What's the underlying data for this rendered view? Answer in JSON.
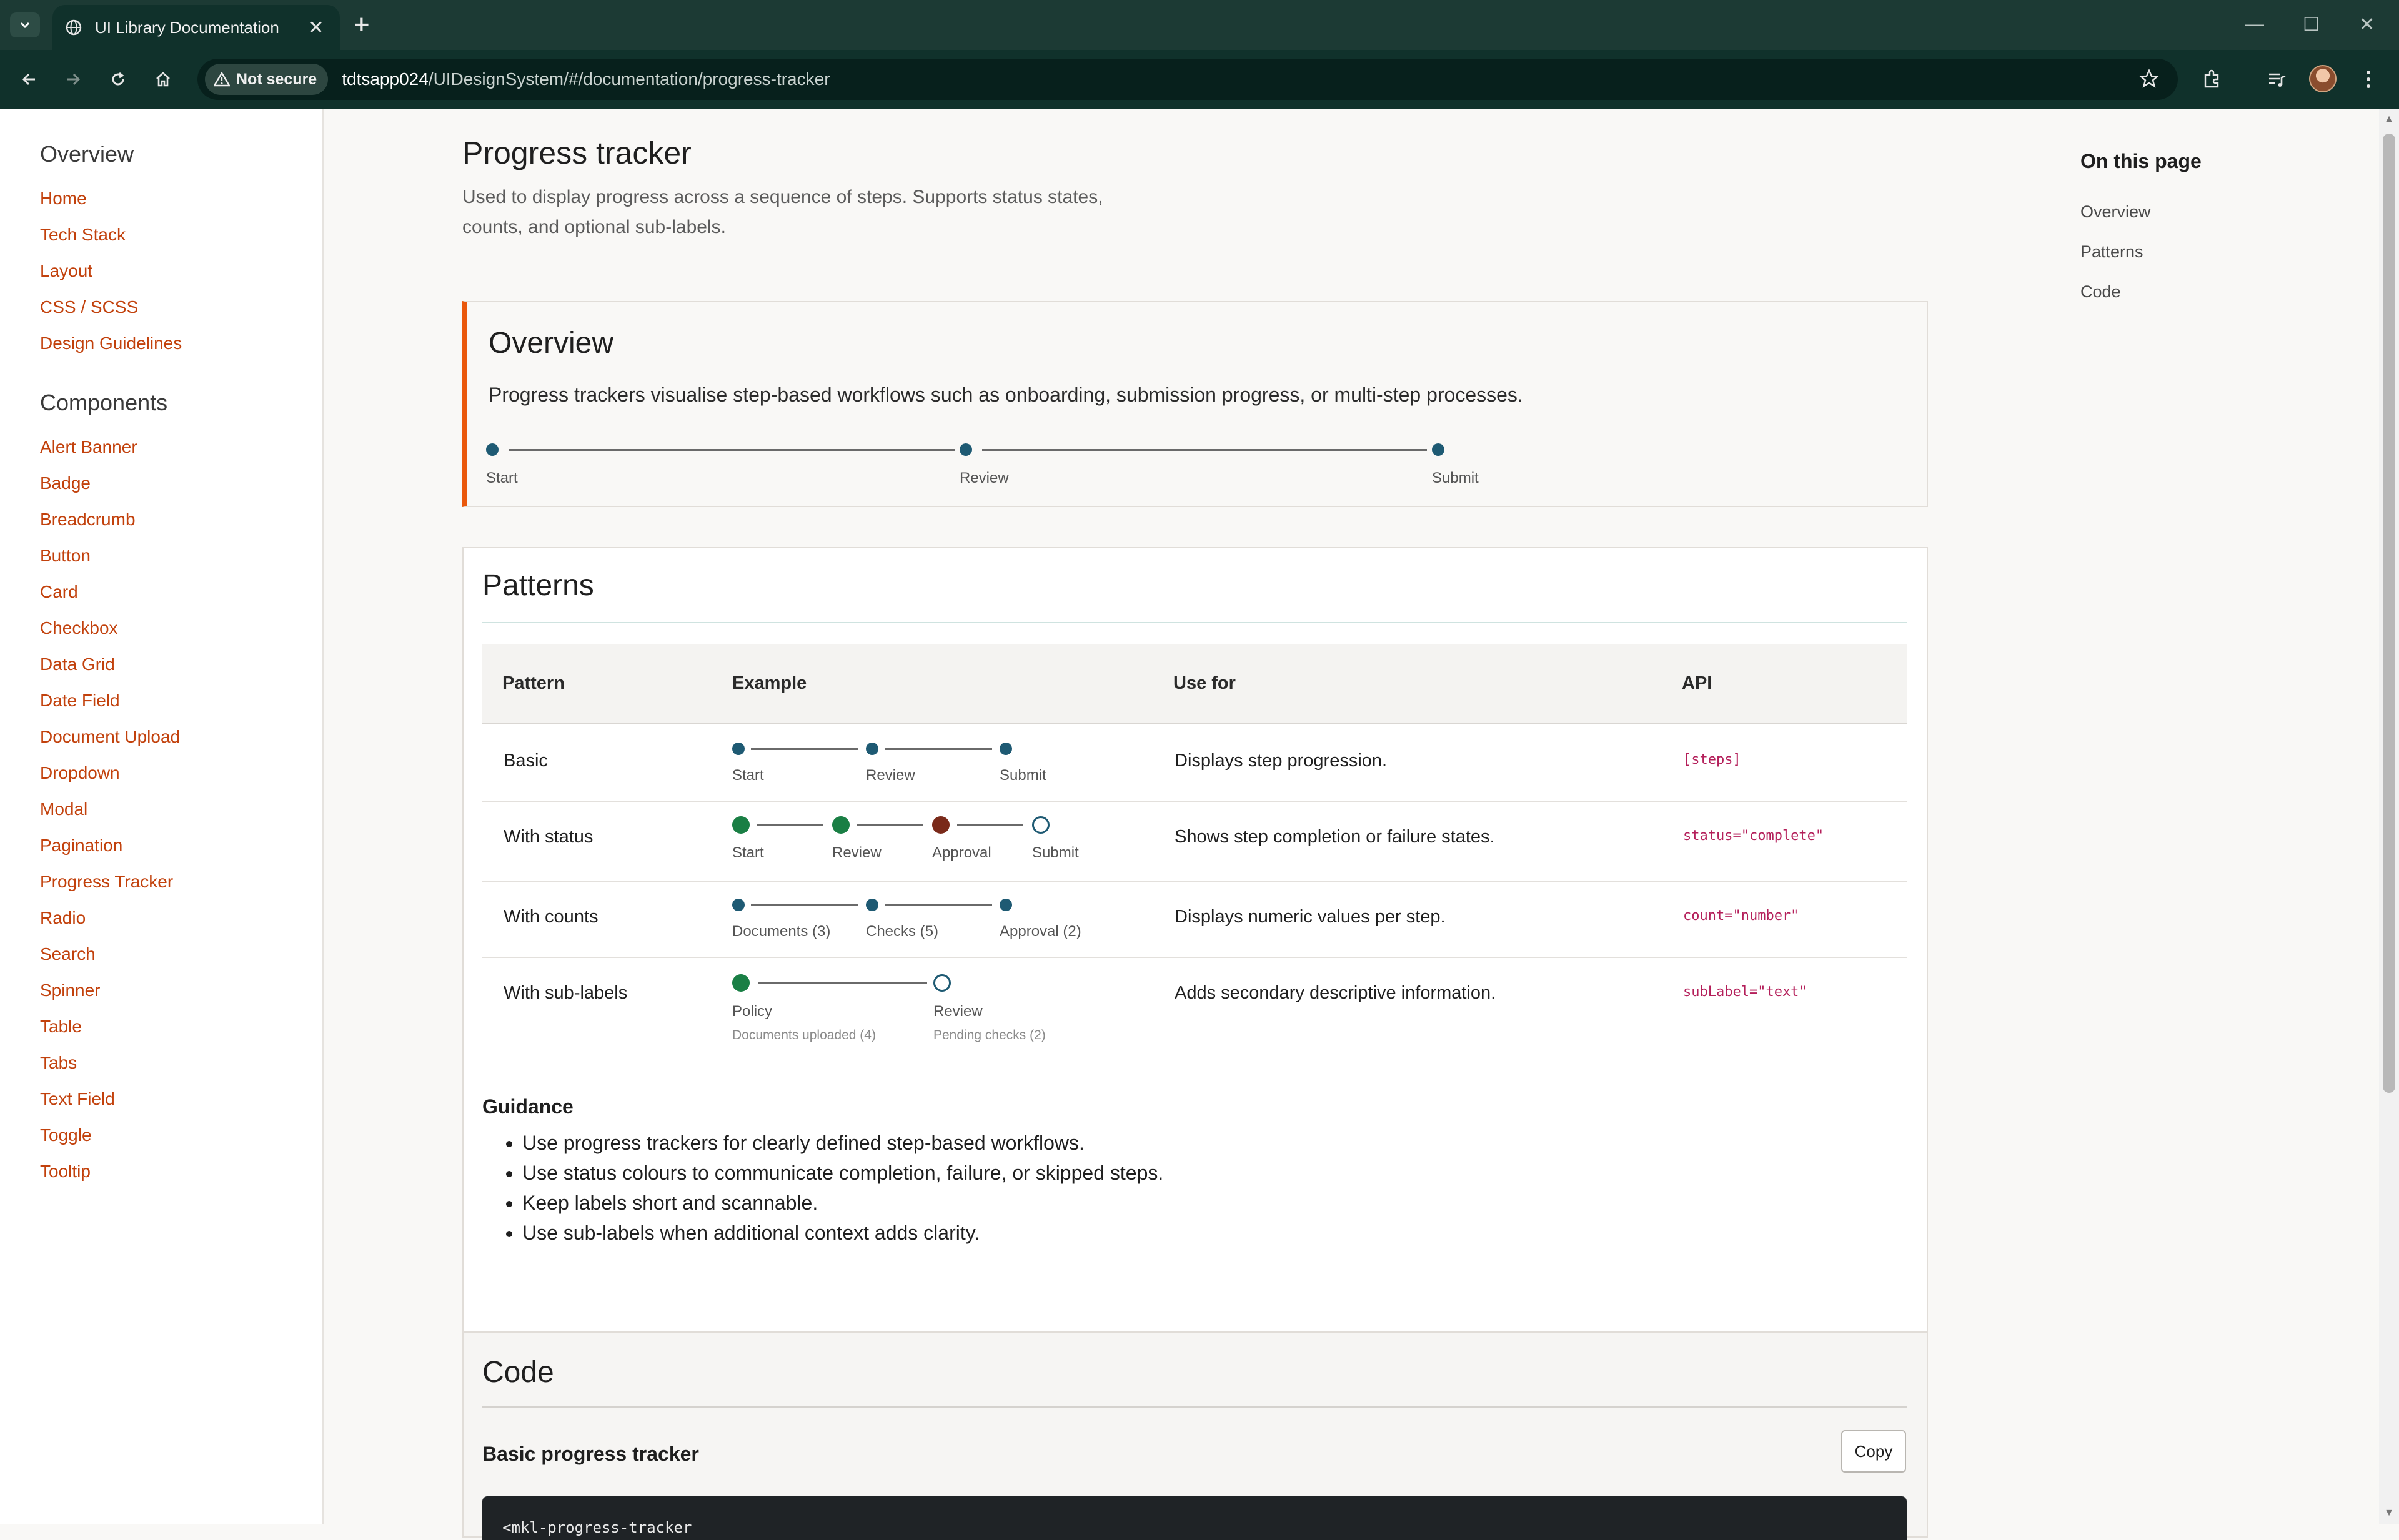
{
  "browser": {
    "tab_title": "UI Library Documentation",
    "security_label": "Not secure",
    "url_host": "tdtsapp024",
    "url_path": "/UIDesignSystem/#/documentation/progress-tracker"
  },
  "sidebar": {
    "overview_heading": "Overview",
    "overview_links": [
      "Home",
      "Tech Stack",
      "Layout",
      "CSS / SCSS",
      "Design Guidelines"
    ],
    "components_heading": "Components",
    "component_links": [
      "Alert Banner",
      "Badge",
      "Breadcrumb",
      "Button",
      "Card",
      "Checkbox",
      "Data Grid",
      "Date Field",
      "Document Upload",
      "Dropdown",
      "Modal",
      "Pagination",
      "Progress Tracker",
      "Radio",
      "Search",
      "Spinner",
      "Table",
      "Tabs",
      "Text Field",
      "Toggle",
      "Tooltip"
    ]
  },
  "page": {
    "title": "Progress tracker",
    "description": "Used to display progress across a sequence of steps. Supports status states, counts, and optional sub-labels."
  },
  "overview": {
    "heading": "Overview",
    "text": "Progress trackers visualise step-based workflows such as onboarding, submission progress, or multi-step processes.",
    "steps": [
      "Start",
      "Review",
      "Submit"
    ]
  },
  "patterns": {
    "heading": "Patterns",
    "columns": [
      "Pattern",
      "Example",
      "Use for",
      "API"
    ],
    "rows": [
      {
        "pattern": "Basic",
        "use_for": "Displays step progression.",
        "api": "[steps]",
        "steps": [
          "Start",
          "Review",
          "Submit"
        ]
      },
      {
        "pattern": "With status",
        "use_for": "Shows step completion or failure states.",
        "api": "status=\"complete\"",
        "steps": [
          "Start",
          "Review",
          "Approval",
          "Submit"
        ]
      },
      {
        "pattern": "With counts",
        "use_for": "Displays numeric values per step.",
        "api": "count=\"number\"",
        "steps": [
          "Documents (3)",
          "Checks (5)",
          "Approval (2)"
        ]
      },
      {
        "pattern": "With sub-labels",
        "use_for": "Adds secondary descriptive information.",
        "api": "subLabel=\"text\"",
        "steps": [
          "Policy",
          "Review"
        ],
        "sub_labels": [
          "Documents uploaded (4)",
          "Pending checks (2)"
        ]
      }
    ],
    "guidance_heading": "Guidance",
    "guidance": [
      "Use progress trackers for clearly defined step-based workflows.",
      "Use status colours to communicate completion, failure, or skipped steps.",
      "Keep labels short and scannable.",
      "Use sub-labels when additional context adds clarity."
    ]
  },
  "code": {
    "heading": "Code",
    "subheading": "Basic progress tracker",
    "copy_label": "Copy",
    "snippet_first_line": "<mkl-progress-tracker"
  },
  "toc": {
    "heading": "On this page",
    "links": [
      "Overview",
      "Patterns",
      "Code"
    ]
  },
  "colors": {
    "accent": "#c2410c",
    "overview_border": "#ea580c",
    "step_dot": "#1e5a73",
    "status_complete": "#1a7f45",
    "status_failed": "#7a2a1a",
    "status_pending": "#1e5a73",
    "api_code": "#b41f5a"
  }
}
